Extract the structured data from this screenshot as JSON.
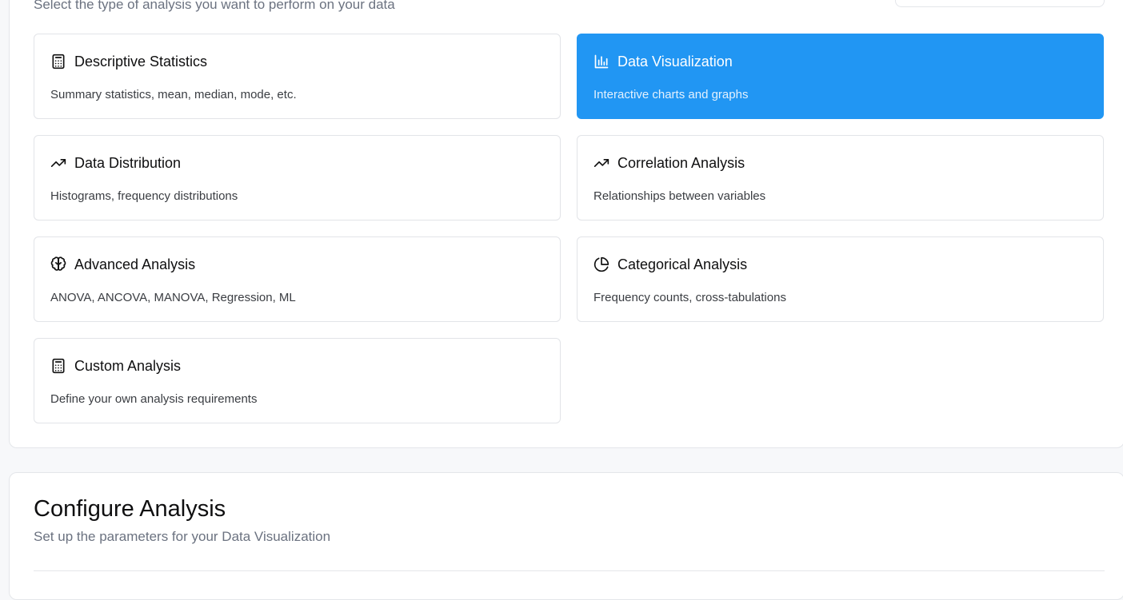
{
  "analysis_type": {
    "subtitle": "Select the type of analysis you want to perform on your data",
    "cards": [
      {
        "title": "Descriptive Statistics",
        "description": "Summary statistics, mean, median, mode, etc.",
        "icon": "calculator-icon",
        "selected": false
      },
      {
        "title": "Data Visualization",
        "description": "Interactive charts and graphs",
        "icon": "bar-chart-icon",
        "selected": true
      },
      {
        "title": "Data Distribution",
        "description": "Histograms, frequency distributions",
        "icon": "trending-up-icon",
        "selected": false
      },
      {
        "title": "Correlation Analysis",
        "description": "Relationships between variables",
        "icon": "trending-up-icon",
        "selected": false
      },
      {
        "title": "Advanced Analysis",
        "description": "ANOVA, ANCOVA, MANOVA, Regression, ML",
        "icon": "brain-icon",
        "selected": false
      },
      {
        "title": "Categorical Analysis",
        "description": "Frequency counts, cross-tabulations",
        "icon": "pie-chart-icon",
        "selected": false
      },
      {
        "title": "Custom Analysis",
        "description": "Define your own analysis requirements",
        "icon": "calculator-icon",
        "selected": false
      }
    ]
  },
  "configure": {
    "title": "Configure Analysis",
    "subtitle": "Set up the parameters for your Data Visualization"
  },
  "colors": {
    "accent": "#2196f3",
    "selected_text": "#ffffff",
    "selected_desc": "#e3f1fe",
    "card_border": "#e2e4e8",
    "page_bg": "#f7f8fa"
  }
}
